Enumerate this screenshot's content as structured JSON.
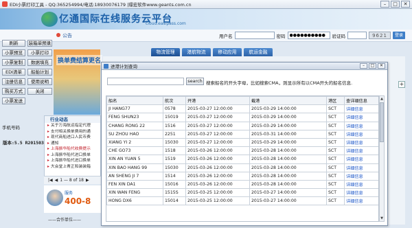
{
  "window": {
    "title": "EDI小票打印工具 - QQ:365254994/电话:18930076179 |璟宏软件www.geants.com.cn",
    "controls": [
      "–",
      "□",
      "✕"
    ]
  },
  "banner": {
    "brand": "亿通国际在线服务云平台",
    "domain": "cloud.easipass.com"
  },
  "notice": {
    "label": "公告",
    "username_label": "用户名",
    "password_label": "密码",
    "password_value": "●●●●●●●●●●",
    "captcha_label": "验证码",
    "captcha_value": "9621",
    "login_label": "登录"
  },
  "toolbar": {
    "buttons": [
      "刷新",
      "装箱单预录",
      "小票预览",
      "小票打印",
      "小票复制",
      "数据填充",
      "EDI清单",
      "船舶计划",
      "注册信息",
      "使用说明",
      "购买方式",
      "关闭",
      "小票发送"
    ],
    "version": "版本:5.5 R20150310",
    "phone_label": "手机号码"
  },
  "promo": {
    "text": "换单费结算更名"
  },
  "news": {
    "heading": "行业动态",
    "items": [
      {
        "text": "关于万海航运指定代理",
        "highlight": false
      },
      {
        "text": "支付相关换单费用的通",
        "highlight": false
      },
      {
        "text": "现代商船进口人民币费",
        "highlight": false
      },
      {
        "text": "通知",
        "highlight": false
      },
      {
        "text": "上海振华船代收费提示",
        "highlight": true
      },
      {
        "text": "上海振华船代进口换单",
        "highlight": false
      },
      {
        "text": "上海振华船代进口换单",
        "highlight": false
      },
      {
        "text": "大会堂上青正和装装箱",
        "highlight": false
      }
    ],
    "pager": "1 — 8 of 18"
  },
  "service": {
    "label": "服务",
    "phone": "400-8",
    "footer": "——合作单位——"
  },
  "tabs": [
    "物流管理",
    "港航物流",
    "移动应用",
    "航运金融"
  ],
  "dialog": {
    "title": "进港计划查询",
    "search_button": "search",
    "search_hint": "搜索船名的开头字母，比如搜索CMA，则显示所有以CMA开头的船名信息.",
    "columns": [
      "船名",
      "航次",
      "开港",
      "截港",
      "港区",
      "查详细信息"
    ],
    "rows": [
      [
        "JI HANG77",
        "0578",
        "2015-03-27 12:00:00",
        "2015-03-29 14:00:00",
        "SCT",
        "详细信息"
      ],
      [
        "FENG SHUN23",
        "15019",
        "2015-03-27 12:00:00",
        "2015-03-29 14:00:00",
        "SCT",
        "详细信息"
      ],
      [
        "CHANG RONG 22",
        "1516",
        "2015-03-27 12:00:00",
        "2015-03-29 14:00:00",
        "SCT",
        "详细信息"
      ],
      [
        "SU ZHOU HAO",
        "2251",
        "2015-03-27 12:00:00",
        "2015-03-31 14:00:00",
        "SCT",
        "详细信息"
      ],
      [
        "XIANG YI 2",
        "15030",
        "2015-03-27 12:00:00",
        "2015-03-29 14:00:00",
        "SCT",
        "详细信息"
      ],
      [
        "CHE GO73",
        "1518",
        "2015-03-26 12:00:00",
        "2015-03-28 14:00:00",
        "SCT",
        "详细信息"
      ],
      [
        "XIN AN YUAN 5",
        "1519",
        "2015-03-26 12:00:00",
        "2015-03-28 14:00:00",
        "SCT",
        "详细信息"
      ],
      [
        "XIN BAO HANG 99",
        "15030",
        "2015-03-26 12:00:00",
        "2015-03-28 14:00:00",
        "SCT",
        "详细信息"
      ],
      [
        "AN SHENG JI 7",
        "1514",
        "2015-03-26 12:00:00",
        "2015-03-28 14:00:00",
        "SCT",
        "详细信息"
      ],
      [
        "FEN XIN DA1",
        "15016",
        "2015-03-26 12:00:00",
        "2015-03-28 14:00:00",
        "SCT",
        "详细信息"
      ],
      [
        "XIN WAN FENG",
        "1515S",
        "2015-03-25 12:00:00",
        "2015-03-27 14:00:00",
        "SCT",
        "详细信息"
      ],
      [
        "HONG DX6",
        "15014",
        "2015-03-25 12:00:00",
        "2015-03-27 14:00:00",
        "SCT",
        "详细信息"
      ]
    ]
  },
  "colors": {
    "tab_blue": "#2d63a8",
    "link_blue": "#1a55c8",
    "brand_blue": "#1a5fa8",
    "alert_red": "#c0202a"
  }
}
